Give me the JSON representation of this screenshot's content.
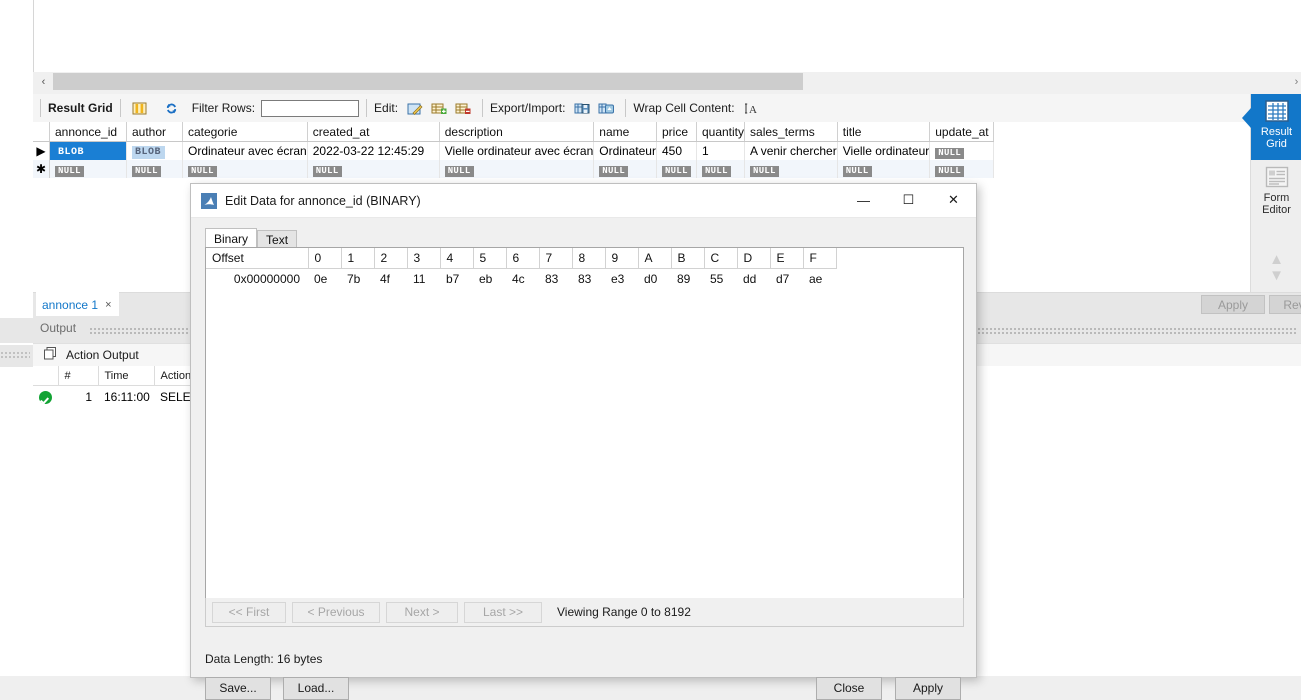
{
  "app": {
    "scrollbar": {
      "left_arrow": "‹",
      "right_arrow": "›"
    }
  },
  "result_toolbar": {
    "title": "Result Grid",
    "grid_icon": "grid-icon",
    "refresh_icon": "refresh-icon",
    "filter_label": "Filter Rows:",
    "filter_value": "",
    "filter_placeholder": "",
    "edit_label": "Edit:",
    "edit_pencil_icon": "edit-pencil-icon",
    "insert_row_icon": "insert-row-icon",
    "delete_row_icon": "delete-row-icon",
    "export_import_label": "Export/Import:",
    "export_icon": "export-icon",
    "import_icon": "import-icon",
    "wrap_label": "Wrap Cell Content:",
    "wrap_icon": "wrap-text-icon"
  },
  "grid": {
    "columns": [
      "annonce_id",
      "author",
      "categorie",
      "created_at",
      "description",
      "name",
      "price",
      "quantity",
      "sales_terms",
      "title",
      "update_at"
    ],
    "rows": [
      {
        "marker": "▶",
        "cells": [
          "BLOB",
          "BLOB",
          "Ordinateur avec écran",
          "2022-03-22 12:45:29",
          "Vielle ordinateur avec écran",
          "Ordinateur",
          "450",
          "1",
          "A venir chercher",
          "Vielle ordinateur",
          "NULL"
        ]
      },
      {
        "marker": "✱",
        "cells": [
          "NULL",
          "NULL",
          "NULL",
          "NULL",
          "NULL",
          "NULL",
          "NULL",
          "NULL",
          "NULL",
          "NULL",
          "NULL"
        ]
      }
    ]
  },
  "side_tabs": [
    {
      "label_line1": "Result",
      "label_line2": "Grid",
      "icon": "result-grid-icon",
      "active": true
    },
    {
      "label_line1": "Form",
      "label_line2": "Editor",
      "icon": "form-editor-icon",
      "active": false
    }
  ],
  "edit_bar": {
    "apply_label": "Apply",
    "revert_label": "Revert",
    "tab_label": "annonce 1",
    "tab_close": "×"
  },
  "output": {
    "panel_title": "Output",
    "action_output_label": "Action Output",
    "action_output_icon": "panels-icon",
    "columns": [
      "#",
      "Time",
      "Action"
    ],
    "rows": [
      {
        "status": "success",
        "num": "1",
        "time": "16:11:00",
        "action": "SELECT"
      }
    ]
  },
  "dialog": {
    "icon": "mysql-dolphin-icon",
    "title": "Edit Data for annonce_id (BINARY)",
    "minimize": "—",
    "maximize": "☐",
    "close": "✕",
    "tabs": [
      {
        "label": "Binary",
        "active": true
      },
      {
        "label": "Text",
        "active": false
      }
    ],
    "hex": {
      "offset_header": "Offset",
      "column_headers": [
        "0",
        "1",
        "2",
        "3",
        "4",
        "5",
        "6",
        "7",
        "8",
        "9",
        "A",
        "B",
        "C",
        "D",
        "E",
        "F"
      ],
      "rows": [
        {
          "offset": "0x00000000",
          "bytes": [
            "0e",
            "7b",
            "4f",
            "11",
            "b7",
            "eb",
            "4c",
            "83",
            "83",
            "e3",
            "d0",
            "89",
            "55",
            "dd",
            "d7",
            "ae"
          ]
        }
      ]
    },
    "nav": {
      "first": "<< First",
      "previous": "< Previous",
      "next": "Next >",
      "last": "Last >>",
      "range_text": "Viewing Range 0 to 8192"
    },
    "data_length": "Data Length: 16 bytes",
    "buttons": {
      "save": "Save...",
      "load": "Load...",
      "close": "Close",
      "apply": "Apply"
    }
  },
  "colors": {
    "accent_blue": "#1277c9",
    "selection_blue": "#1a7fd4",
    "blob_chip": "#bdd7ef",
    "null_chip": "#8a8a8a",
    "success_green": "#12a334",
    "link_blue": "#1277c9"
  }
}
